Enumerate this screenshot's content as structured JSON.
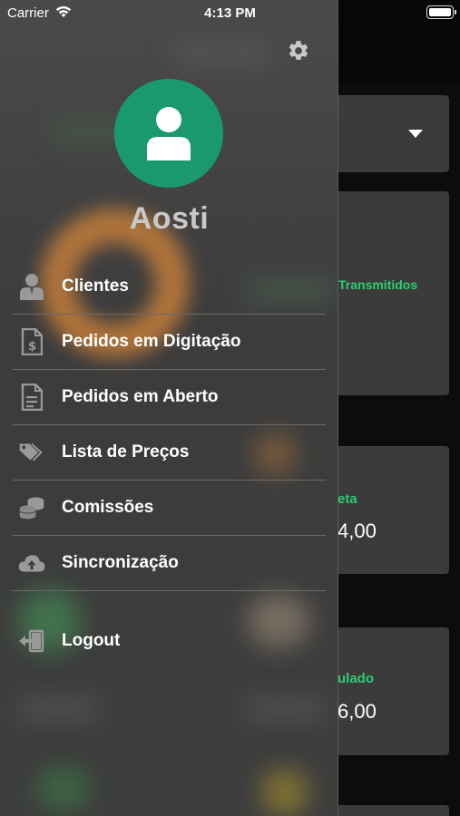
{
  "status_bar": {
    "carrier": "Carrier",
    "time": "4:13 PM",
    "wifi_icon": "wifi-icon",
    "battery_icon": "battery-icon"
  },
  "drawer": {
    "settings_icon": "gear-icon",
    "avatar_icon": "user-icon",
    "avatar_color": "#1a9a6c",
    "user_name": "Aosti",
    "menu_items": [
      {
        "label": "Clientes",
        "icon": "person-icon"
      },
      {
        "label": "Pedidos em Digitação",
        "icon": "invoice-dollar-icon"
      },
      {
        "label": "Pedidos em Aberto",
        "icon": "document-icon"
      },
      {
        "label": "Lista de Preços",
        "icon": "price-tags-icon"
      },
      {
        "label": "Comissões",
        "icon": "coins-icon"
      },
      {
        "label": "Sincronização",
        "icon": "cloud-upload-icon"
      }
    ],
    "logout": {
      "label": "Logout",
      "icon": "logout-icon"
    }
  },
  "background": {
    "dropdown_icon": "caret-down-icon",
    "card_transmitidos_label": "Transmitidos",
    "card_meta_label": "eta",
    "card_meta_value": "4,00",
    "card_acumulado_label": "ulado",
    "card_acumulado_value": "6,00",
    "accent_color": "#2ecc71"
  }
}
